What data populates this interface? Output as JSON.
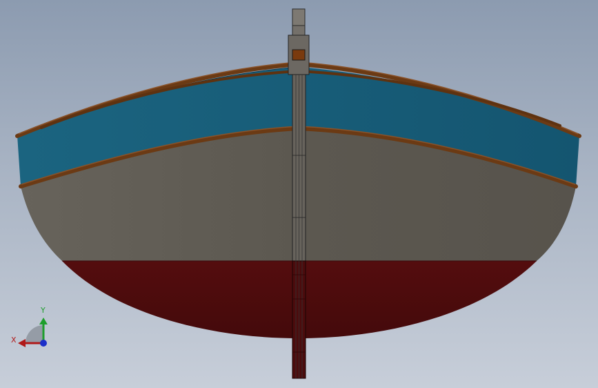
{
  "viewport": {
    "background_top": "#8c9bb0",
    "background_bottom": "#c7ced9"
  },
  "model": {
    "parts": [
      {
        "name": "sheer-strake",
        "color": "#1b5e79"
      },
      {
        "name": "topsides",
        "color": "#5e5a52"
      },
      {
        "name": "bottom-hull",
        "color": "#4a0c0d"
      },
      {
        "name": "gunwale",
        "color": "#6b3a14"
      },
      {
        "name": "rubrail",
        "color": "#6b3a14"
      },
      {
        "name": "centerboard-post",
        "color": "#6c6862"
      },
      {
        "name": "post-block-inlay",
        "color": "#7a3a0e"
      }
    ]
  },
  "triad": {
    "x_label": "X",
    "y_label": "Y",
    "x_color": "#b01919",
    "y_color": "#1e9e2c",
    "z_color": "#1b2fc9"
  }
}
